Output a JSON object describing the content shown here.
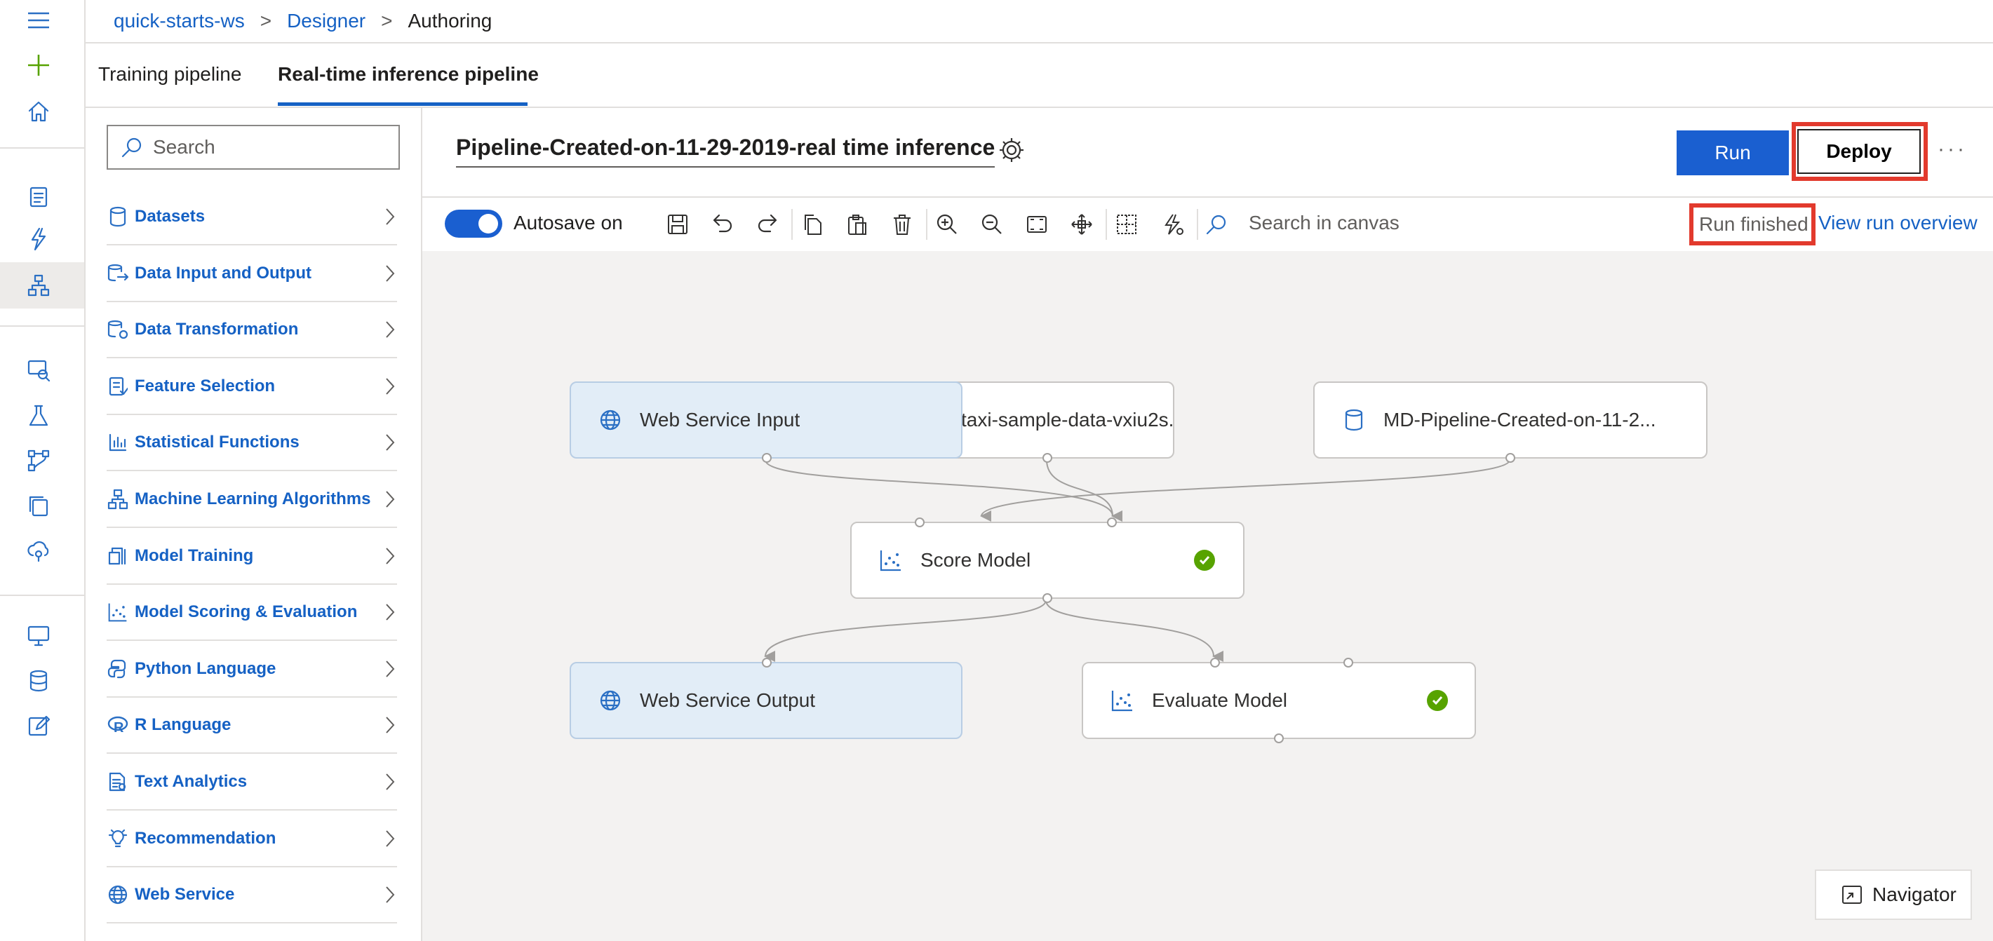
{
  "breadcrumb": {
    "workspace": "quick-starts-ws",
    "section": "Designer",
    "current": "Authoring",
    "separator": ">"
  },
  "tabs": [
    {
      "label": "Training pipeline",
      "active": false
    },
    {
      "label": "Real-time inference pipeline",
      "active": true
    }
  ],
  "palette": {
    "search_placeholder": "Search",
    "categories": [
      {
        "label": "Datasets",
        "icon": "database-icon"
      },
      {
        "label": "Data Input and Output",
        "icon": "data-io-icon"
      },
      {
        "label": "Data Transformation",
        "icon": "data-transform-icon"
      },
      {
        "label": "Feature Selection",
        "icon": "feature-selection-icon"
      },
      {
        "label": "Statistical Functions",
        "icon": "bar-chart-icon"
      },
      {
        "label": "Machine Learning Algorithms",
        "icon": "ml-algorithm-icon"
      },
      {
        "label": "Model Training",
        "icon": "model-training-icon"
      },
      {
        "label": "Model Scoring & Evaluation",
        "icon": "scatter-icon"
      },
      {
        "label": "Python Language",
        "icon": "python-icon"
      },
      {
        "label": "R Language",
        "icon": "r-language-icon"
      },
      {
        "label": "Text Analytics",
        "icon": "text-analytics-icon"
      },
      {
        "label": "Recommendation",
        "icon": "lightbulb-icon"
      },
      {
        "label": "Web Service",
        "icon": "globe-icon"
      }
    ]
  },
  "header": {
    "pipeline_title": "Pipeline-Created-on-11-29-2019-real time inference",
    "run_label": "Run",
    "deploy_label": "Deploy",
    "more_label": "···"
  },
  "toolbar": {
    "autosave_label": "Autosave on",
    "autosave_on": true,
    "search_placeholder": "Search in canvas",
    "status": "Run finished",
    "view_run_label": "View run overview"
  },
  "nodes": [
    {
      "id": "web-service-input",
      "label": "Web Service Input",
      "icon": "globe-icon",
      "status": null
    },
    {
      "id": "taxi-data",
      "label": "taxi-sample-data-vxiu2s...",
      "icon": null,
      "status": null
    },
    {
      "id": "md-pipeline",
      "label": "MD-Pipeline-Created-on-11-2...",
      "icon": "database-icon",
      "status": null
    },
    {
      "id": "score-model",
      "label": "Score Model",
      "icon": "scatter-icon",
      "status": "completed"
    },
    {
      "id": "web-service-output",
      "label": "Web Service Output",
      "icon": "globe-icon",
      "status": null
    },
    {
      "id": "evaluate-model",
      "label": "Evaluate Model",
      "icon": "scatter-icon",
      "status": "completed"
    }
  ],
  "navigator_label": "Navigator",
  "colors": {
    "accent": "#1a5fd0",
    "link": "#1561c4",
    "highlight": "#e23a2d",
    "success": "#57a300",
    "canvas_bg": "#f3f2f1",
    "webservice_node_bg": "#e2edf7"
  }
}
